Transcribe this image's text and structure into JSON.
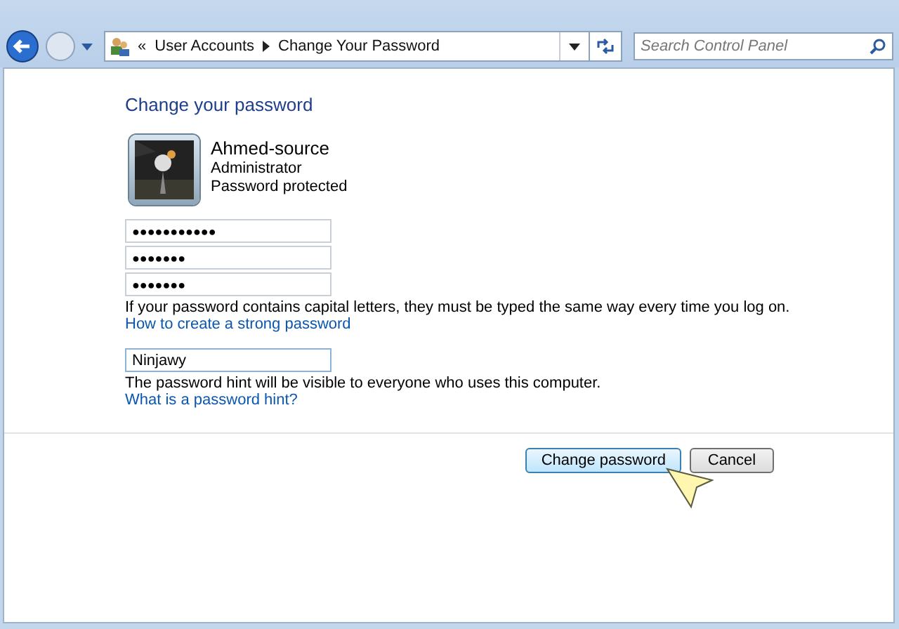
{
  "address_bar": {
    "prefix": "«",
    "breadcrumbs": [
      "User Accounts",
      "Change Your Password"
    ]
  },
  "search": {
    "placeholder": "Search Control Panel"
  },
  "heading": "Change your password",
  "user": {
    "name": "Ahmed-source",
    "role": "Administrator",
    "status": "Password protected"
  },
  "password_fields": [
    {
      "value": "●●●●●●●●●●●"
    },
    {
      "value": "●●●●●●●"
    },
    {
      "value": "●●●●●●●"
    }
  ],
  "capital_note": "If your password contains capital letters, they must be typed the same way every time you log on.",
  "strong_link": "How to create a strong password",
  "hint_field": {
    "value": "Ninjawy"
  },
  "hint_note": "The password hint will be visible to everyone who uses this computer.",
  "hint_link": "What is a password hint?",
  "buttons": [
    {
      "label": "Change password",
      "default": true
    },
    {
      "label": "Cancel",
      "default": false
    }
  ]
}
